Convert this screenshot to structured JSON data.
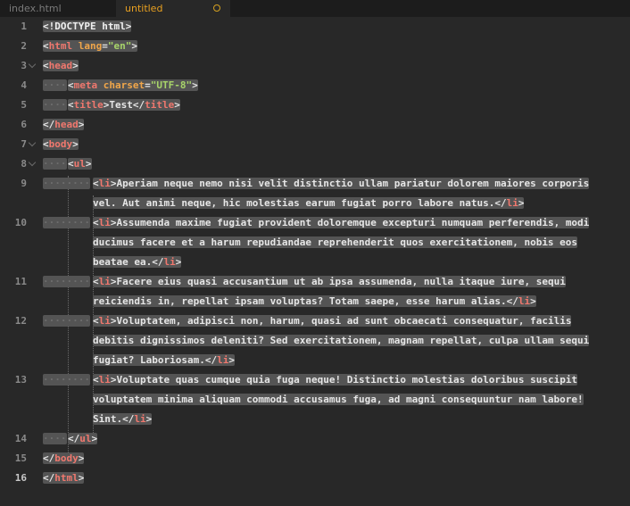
{
  "tabs": [
    {
      "label": "index.html",
      "active": false
    },
    {
      "label": "untitled",
      "active": true,
      "dirty": true
    }
  ],
  "editor": {
    "line_numbers": [
      "1",
      "2",
      "3",
      "4",
      "5",
      "6",
      "7",
      "8",
      "9",
      "10",
      "11",
      "12",
      "13",
      "14",
      "15",
      "16"
    ],
    "lines": {
      "l1": "<!DOCTYPE html>",
      "l2_tag": "html",
      "l2_attr": "lang",
      "l2_val": "\"en\"",
      "l3_tag": "head",
      "l4_tag": "meta",
      "l4_attr": "charset",
      "l4_val": "\"UTF-8\"",
      "l5_tag": "title",
      "l5_text": "Test",
      "l6_tag": "head",
      "l7_tag": "body",
      "l8_tag": "ul",
      "li_tag": "li",
      "l9_text_a": "Aperiam neque nemo nisi velit distinctio ullam pariatur dolorem maiores corporis",
      "l9_text_b": "vel. Aut animi neque, hic molestias earum fugiat porro labore natus.",
      "l10_text_a": "Assumenda maxime fugiat provident doloremque excepturi numquam perferendis, modi",
      "l10_text_b": "ducimus facere et a harum repudiandae reprehenderit quos exercitationem, nobis eos",
      "l10_text_c": "beatae ea.",
      "l11_text_a": "Facere eius quasi accusantium ut ab ipsa assumenda, nulla itaque iure, sequi",
      "l11_text_b": "reiciendis in, repellat ipsam voluptas? Totam saepe, esse harum alias.",
      "l12_text_a": "Voluptatem, adipisci non, harum, quasi ad sunt obcaecati consequatur, facilis",
      "l12_text_b": "debitis dignissimos deleniti? Sed exercitationem, magnam repellat, culpa ullam sequi",
      "l12_text_c": "fugiat? Laboriosam.",
      "l13_text_a": "Voluptate quas cumque quia fuga neque! Distinctio molestias doloribus suscipit",
      "l13_text_b": "voluptatem minima aliquam commodi accusamus fuga, ad magni consequuntur nam labore!",
      "l13_text_c": "Sint.",
      "l14_tag": "ul",
      "l15_tag": "body",
      "l16_tag": "html"
    }
  },
  "colors": {
    "background": "#282828",
    "selection": "#545454",
    "tag": "#f0786e",
    "attribute": "#f0a64a",
    "string": "#a8d46a",
    "tab_active_text": "#e8a020"
  }
}
